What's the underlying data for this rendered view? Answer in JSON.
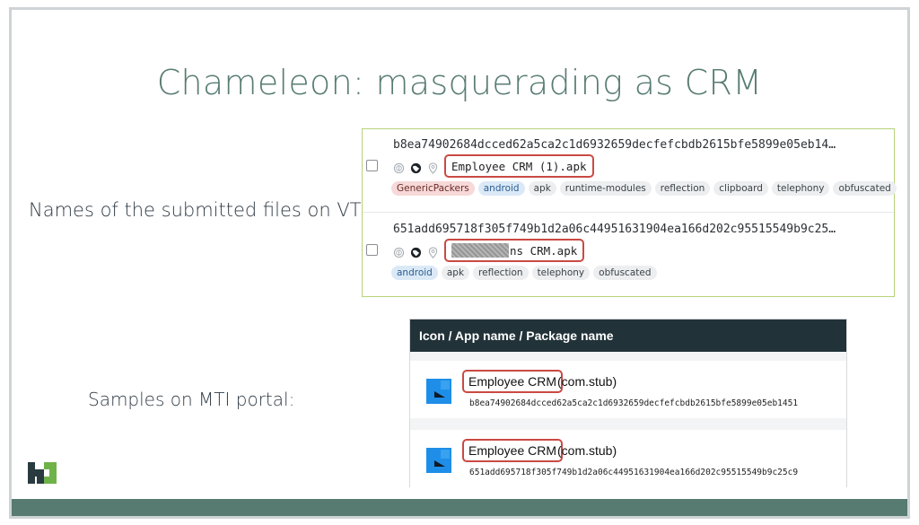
{
  "slide": {
    "title": "Chameleon: masquerading as CRM",
    "vt_label": "Names of the submitted files on VT:",
    "mti_label": "Samples on MTI portal:"
  },
  "vt": {
    "rows": [
      {
        "hash": "b8ea74902684dcced62a5ca2c1d6932659decfefcbdb2615bfe5899e05eb14…",
        "filename": "Employee CRM (1).apk",
        "tags": [
          {
            "label": "GenericPackers",
            "style": "red"
          },
          {
            "label": "android",
            "style": "blue"
          },
          {
            "label": "apk",
            "style": "gray"
          },
          {
            "label": "runtime-modules",
            "style": "gray"
          },
          {
            "label": "reflection",
            "style": "gray"
          },
          {
            "label": "clipboard",
            "style": "gray"
          },
          {
            "label": "telephony",
            "style": "gray"
          },
          {
            "label": "obfuscated",
            "style": "gray"
          }
        ]
      },
      {
        "hash": "651add695718f305f749b1d2a06c44951631904ea166d202c95515549b9c25…",
        "filename": "ns CRM.apk",
        "tags": [
          {
            "label": "android",
            "style": "blue"
          },
          {
            "label": "apk",
            "style": "gray"
          },
          {
            "label": "reflection",
            "style": "gray"
          },
          {
            "label": "telephony",
            "style": "gray"
          },
          {
            "label": "obfuscated",
            "style": "gray"
          }
        ]
      }
    ],
    "icons": [
      "fingerprint-icon",
      "globe-icon",
      "location-pin-icon"
    ]
  },
  "mti": {
    "header": "Icon / App name / Package name",
    "rows": [
      {
        "app_name": "Employee CRM",
        "package": "(com.stub)",
        "hash": "b8ea74902684dcced62a5ca2c1d6932659decfefcbdb2615bfe5899e05eb1451"
      },
      {
        "app_name": "Employee CRM",
        "package": "(com.stub)",
        "hash": "651add695718f305f749b1d2a06c44951631904ea166d202c95515549b9c25c9"
      }
    ]
  },
  "colors": {
    "title": "#587c73",
    "accent_bar": "#577b70",
    "highlight_box": "#c94a43",
    "vt_border": "#b7d37a",
    "mti_header_bg": "#223239",
    "app_icon_blue": "#1e8ee8"
  }
}
